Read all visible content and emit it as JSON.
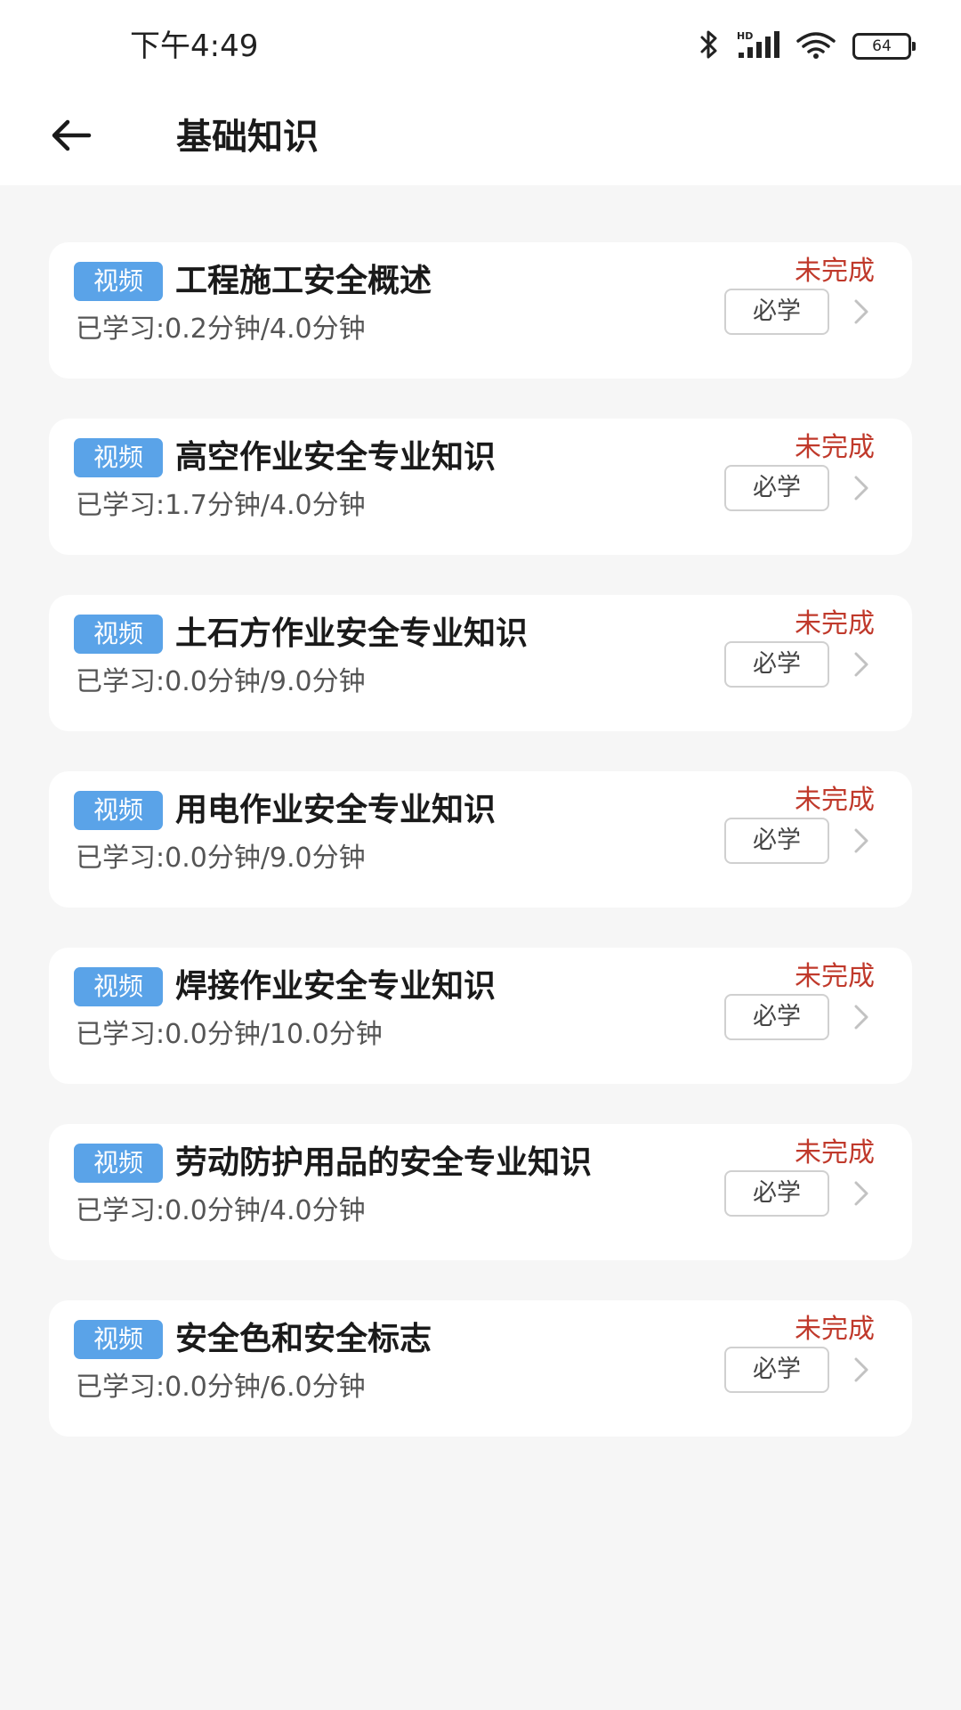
{
  "status_bar": {
    "time": "下午4:49",
    "battery": "64"
  },
  "header": {
    "title": "基础知识"
  },
  "courses": [
    {
      "tag": "视频",
      "title": "工程施工安全概述",
      "progress": "已学习:0.2分钟/4.0分钟",
      "status": "未完成",
      "badge": "必学"
    },
    {
      "tag": "视频",
      "title": "高空作业安全专业知识",
      "progress": "已学习:1.7分钟/4.0分钟",
      "status": "未完成",
      "badge": "必学"
    },
    {
      "tag": "视频",
      "title": "土石方作业安全专业知识",
      "progress": "已学习:0.0分钟/9.0分钟",
      "status": "未完成",
      "badge": "必学"
    },
    {
      "tag": "视频",
      "title": "用电作业安全专业知识",
      "progress": "已学习:0.0分钟/9.0分钟",
      "status": "未完成",
      "badge": "必学"
    },
    {
      "tag": "视频",
      "title": "焊接作业安全专业知识",
      "progress": "已学习:0.0分钟/10.0分钟",
      "status": "未完成",
      "badge": "必学"
    },
    {
      "tag": "视频",
      "title": "劳动防护用品的安全专业知识",
      "progress": "已学习:0.0分钟/4.0分钟",
      "status": "未完成",
      "badge": "必学"
    },
    {
      "tag": "视频",
      "title": "安全色和安全标志",
      "progress": "已学习:0.0分钟/6.0分钟",
      "status": "未完成",
      "badge": "必学"
    }
  ]
}
